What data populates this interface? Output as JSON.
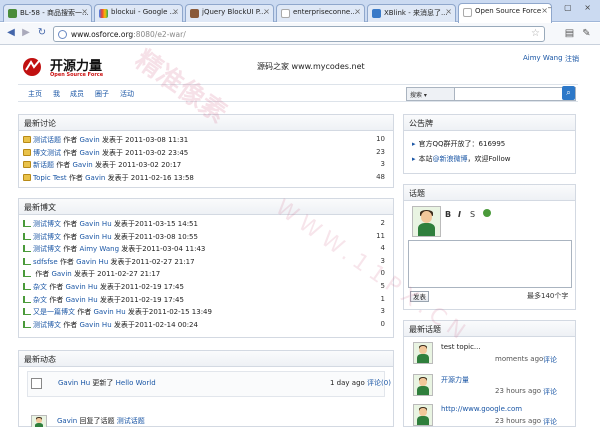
{
  "browser": {
    "tabs": [
      {
        "title": "BL-58 - 商品搜索一..."
      },
      {
        "title": "blockui - Google ..."
      },
      {
        "title": "jQuery BlockUI P..."
      },
      {
        "title": "enterpriseconne..."
      },
      {
        "title": "XBlink - 来消息了..."
      },
      {
        "title": "Open Source Force"
      }
    ],
    "url_host": "www.osforce.org",
    "url_path": ":8080/e2-war/"
  },
  "site": {
    "logo_title": "开源力量",
    "logo_subtitle": "Open Source Force",
    "caption": "源码之家 www.mycodes.net",
    "user_name": "Aimy Wang",
    "logout": "注销"
  },
  "nav": {
    "items": [
      "主页",
      "我",
      "成员",
      "圈子",
      "活动"
    ],
    "search_select": "搜索"
  },
  "discussions": {
    "title": "最新讨论",
    "rows": [
      {
        "title": "测试话题",
        "by": "作者",
        "author": "Gavin",
        "posted": "发表于 2011-03-08 11:31",
        "count": "10"
      },
      {
        "title": "博文测试",
        "by": "作者",
        "author": "Gavin",
        "posted": "发表于 2011-03-02 23:45",
        "count": "23"
      },
      {
        "title": "新话题",
        "by": "作者",
        "author": "Gavin",
        "posted": "发表于 2011-03-02 20:17",
        "count": "3"
      },
      {
        "title": "Topic Test",
        "by": "作者",
        "author": "Gavin",
        "posted": "发表于 2011-02-16 13:58",
        "count": "48"
      }
    ]
  },
  "blogs": {
    "title": "最新博文",
    "rows": [
      {
        "title": "测试博文",
        "by": "作者",
        "author": "Gavin Hu",
        "posted": "发表于2011-03-15 14:51",
        "count": "2"
      },
      {
        "title": "测试博文",
        "by": "作者",
        "author": "Gavin Hu",
        "posted": "发表于2011-03-08 10:55",
        "count": "11"
      },
      {
        "title": "测试博文",
        "by": "作者",
        "author": "Aimy Wang",
        "posted": "发表于2011-03-04 11:43",
        "count": "4"
      },
      {
        "title": "sdfsfse",
        "by": "作者",
        "author": "Gavin Hu",
        "posted": "发表于2011-02-27 21:17",
        "count": "3"
      },
      {
        "title": "",
        "by": "作者",
        "author": "Gavin",
        "posted": "发表于 2011-02-27 21:17",
        "count": "0"
      },
      {
        "title": "杂文",
        "by": "作者",
        "author": "Gavin Hu",
        "posted": "发表于2011-02-19 17:45",
        "count": "5"
      },
      {
        "title": "杂文",
        "by": "作者",
        "author": "Gavin Hu",
        "posted": "发表于2011-02-19 17:45",
        "count": "1"
      },
      {
        "title": "又是一篇博文",
        "by": "作者",
        "author": "Gavin Hu",
        "posted": "发表于2011-02-15 13:49",
        "count": "3"
      },
      {
        "title": "测试博文",
        "by": "作者",
        "author": "Gavin Hu",
        "posted": "发表于2011-02-14 00:24",
        "count": "0"
      }
    ]
  },
  "activity": {
    "title": "最新动态",
    "items": [
      {
        "author": "Gavin Hu",
        "action": "更新了",
        "target": "Hello World",
        "time": "1 day ago",
        "comments": "评论(0)"
      },
      {
        "author": "Gavin",
        "action": "回复了话题",
        "target": "测试话题"
      }
    ]
  },
  "announcement": {
    "title": "公告牌",
    "items": [
      {
        "text": "官方QQ群开放了：616995"
      },
      {
        "prefix": "本站",
        "link": "@新浪微博",
        "suffix": "，欢迎Follow"
      }
    ]
  },
  "topic_box": {
    "title": "话题",
    "format_buttons": [
      "B",
      "I",
      "S"
    ],
    "post_label": "发表",
    "char_limit": "最多140个字"
  },
  "latest_topics": {
    "title": "最新话题",
    "items": [
      {
        "text": "test topic...",
        "time": "moments ago",
        "comment": "评论"
      },
      {
        "text": "开源力量",
        "time": "23 hours ago",
        "comment": "评论"
      },
      {
        "text": "http://www.google.com",
        "time": "23 hours ago",
        "comment": "评论"
      }
    ]
  },
  "watermark": {
    "text1": "精准像素",
    "text2": "WWW.11PX.CN"
  },
  "colors": {
    "link": "#1a56a5",
    "brand_red": "#c11111",
    "search_button": "#2d78c8"
  }
}
